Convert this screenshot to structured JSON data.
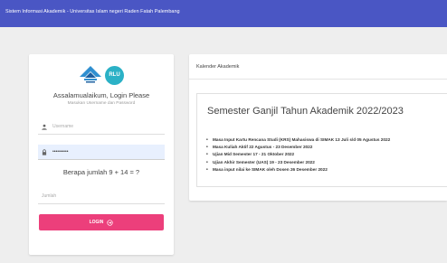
{
  "header": {
    "title": "Sistem Informasi Akademik - Universitas Islam negeri Raden Fatah Palembang"
  },
  "login": {
    "logo_text": "RLU",
    "greeting": "Assalamualaikum, Login Please",
    "subtitle": "Masukan Username dan Password",
    "username_placeholder": "Username",
    "username_icon": "user-icon",
    "password_value": "••••••••••",
    "password_icon": "lock-icon",
    "captcha_question": "Berapa jumlah 9 + 14 = ?",
    "answer_placeholder": "Jumlah",
    "button_label": "LOGIN",
    "button_icon": "arrow-circle-right-icon",
    "button_color": "#ec3f7b"
  },
  "calendar": {
    "title": "Kalender Akademik",
    "semester_title": "Semester Ganjil Tahun Akademik 2022/2023",
    "items": [
      "Masa Input Kartu Rencana Studi (KRS) Mahasiswa di SIMAK 13 Juli s/d 05 Agustus 2022",
      "Masa Kuliah Aktif 22 Agustus - 23 Desember 2022",
      "Ujian Mid Semester 17 - 21 Oktober 2022",
      "Ujian Akhir Semester (UAS) 19 - 23 Desember 2022",
      "Masa input nilai ke SIMAK oleh Dosen 26 Desember 2022"
    ]
  },
  "colors": {
    "topbar": "#4a56c4",
    "background": "#eeeeee",
    "accent": "#ec3f7b",
    "logo_teal": "#2bb1c6"
  }
}
